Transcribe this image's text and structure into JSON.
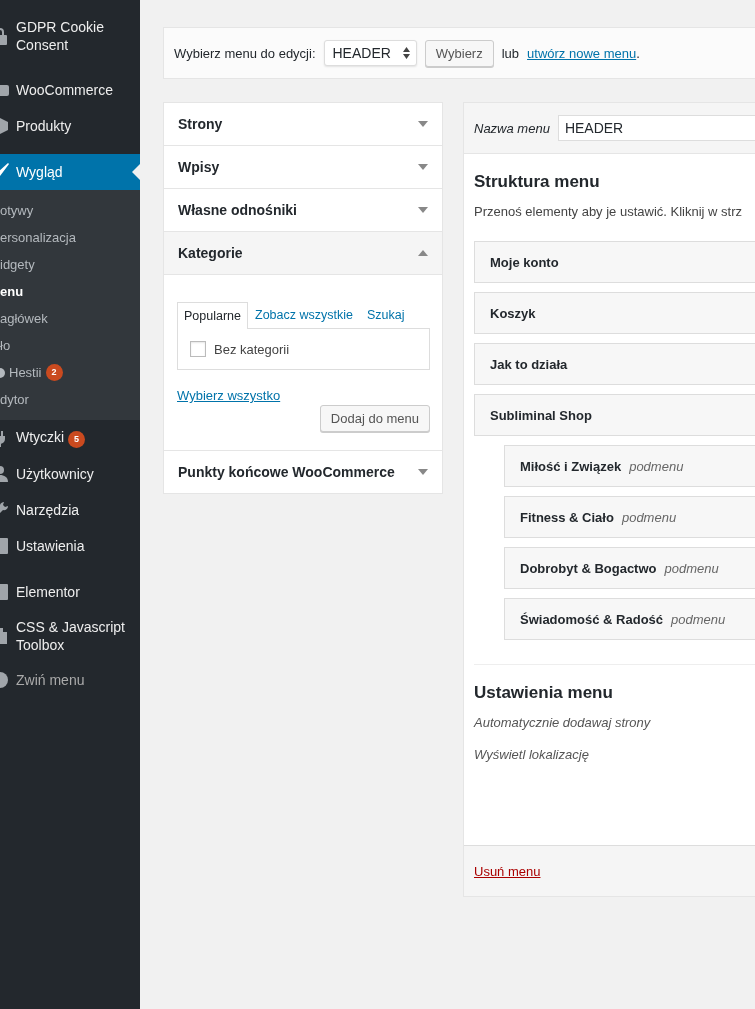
{
  "sidebar": {
    "groups": [
      [
        {
          "label": "GDPR Cookie Consent",
          "selected": false
        }
      ],
      [
        {
          "label": "WooCommerce",
          "selected": false
        },
        {
          "label": "Produkty",
          "selected": false
        }
      ],
      [
        {
          "label": "Wygląd",
          "selected": true,
          "children": [
            {
              "label": "otywy",
              "kind": "plain",
              "selected": false
            },
            {
              "label": "ersonalizacja",
              "kind": "plain",
              "selected": false
            },
            {
              "label": "idgety",
              "kind": "plain",
              "selected": false
            },
            {
              "label": "enu",
              "kind": "plain",
              "selected": true
            },
            {
              "label": "agłówek",
              "kind": "plain",
              "selected": false
            },
            {
              "label": "ło",
              "kind": "plain",
              "selected": false
            },
            {
              "label": "Hestii",
              "kind": "with-icon",
              "selected": false,
              "badge": "2"
            },
            {
              "label": "dytor",
              "kind": "plain",
              "selected": false
            }
          ]
        },
        {
          "label": "Wtyczki",
          "selected": false,
          "badge": "5"
        },
        {
          "label": "Użytkownicy",
          "selected": false
        },
        {
          "label": "Narzędzia",
          "selected": false
        },
        {
          "label": "Ustawienia",
          "selected": false
        }
      ],
      [
        {
          "label": "Elementor",
          "selected": false
        },
        {
          "label": "CSS & Javascript Toolbox",
          "selected": false
        },
        {
          "label": "Zwiń menu",
          "selected": false,
          "kind": "collapse"
        }
      ]
    ]
  },
  "menu_select": {
    "label": "Wybierz menu do edycji:",
    "value": "HEADER",
    "button": "Wybierz",
    "text": "lub",
    "link": "utwórz nowe menu",
    "after": "."
  },
  "accordion": [
    {
      "title": "Strony",
      "expanded": false
    },
    {
      "title": "Wpisy",
      "expanded": false
    },
    {
      "title": "Własne odnośniki",
      "expanded": false
    },
    {
      "title": "Kategorie",
      "expanded": true,
      "tabs": [
        {
          "label": "Popularne",
          "selected": true
        },
        {
          "label": "Zobacz wszystkie",
          "selected": false
        },
        {
          "label": "Szukaj",
          "selected": false
        }
      ],
      "options": [
        {
          "label": "Bez kategorii",
          "checked": false
        }
      ],
      "select_all": "Wybierz wszystko",
      "button": "Dodaj do menu"
    },
    {
      "title": "Punkty końcowe WooCommerce",
      "expanded": false
    }
  ],
  "menu_editor": {
    "name_label": "Nazwa menu",
    "name_value": "HEADER",
    "structure_title": "Struktura menu",
    "structure_description": "Przenoś elementy aby je ustawić. Kliknij w strz",
    "items": [
      {
        "title": "Moje konto"
      },
      {
        "title": "Koszyk"
      },
      {
        "title": "Jak to działa"
      },
      {
        "title": "Subliminal Shop",
        "children": [
          {
            "title": "Miłość i Związek",
            "note": "podmenu"
          },
          {
            "title": "Fitness & Ciało",
            "note": "podmenu"
          },
          {
            "title": "Dobrobyt & Bogactwo",
            "note": "podmenu"
          },
          {
            "title": "Świadomość & Radość",
            "note": "podmenu"
          }
        ]
      }
    ],
    "settings_title": "Ustawienia menu",
    "settings": [
      "Automatycznie dodawaj strony",
      "Wyświetl lokalizację"
    ],
    "delete_link": "Usuń menu"
  }
}
